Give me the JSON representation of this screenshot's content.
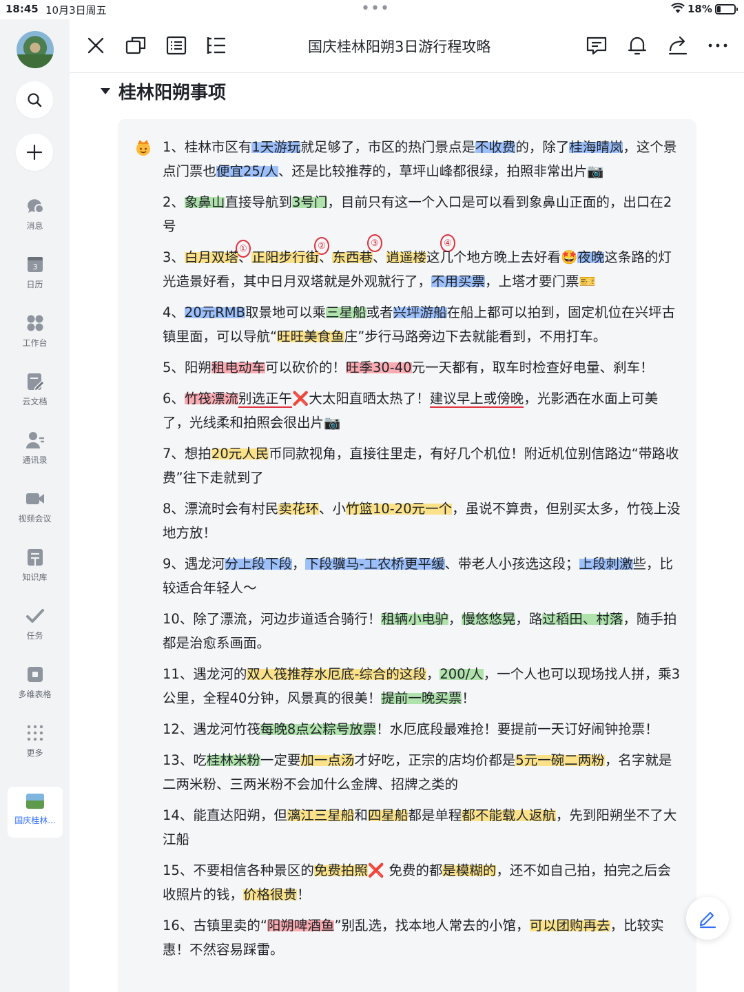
{
  "status": {
    "time": "18:45",
    "date": "10月3日周五",
    "dots": "•••",
    "battery": "18%"
  },
  "sidebar": {
    "items": [
      {
        "label": "消息",
        "icon": "message-icon"
      },
      {
        "label": "日历",
        "icon": "calendar-icon",
        "badge": "3"
      },
      {
        "label": "工作台",
        "icon": "workspace-icon"
      },
      {
        "label": "云文档",
        "icon": "cloud-doc-icon"
      },
      {
        "label": "通讯录",
        "icon": "contacts-icon"
      },
      {
        "label": "视频会议",
        "icon": "video-icon"
      },
      {
        "label": "知识库",
        "icon": "wiki-icon"
      },
      {
        "label": "任务",
        "icon": "task-icon"
      },
      {
        "label": "多维表格",
        "icon": "base-icon"
      },
      {
        "label": "更多",
        "icon": "more-icon"
      }
    ],
    "active_doc": "国庆桂林..."
  },
  "header": {
    "title": "国庆桂林阳朔3日游行程攻略"
  },
  "section": {
    "heading": "桂林阳朔事项"
  },
  "hand_numbers": [
    "①",
    "②",
    "③",
    "④"
  ],
  "items": [
    {
      "segs": [
        [
          "1、桂林市区有",
          ""
        ],
        [
          "1天游玩",
          ""
        ],
        [
          "就足够了，市区的热门景点是",
          ""
        ],
        [
          "不收费",
          ""
        ],
        [
          "的，除了",
          ""
        ],
        [
          "桂海晴岚",
          ""
        ],
        [
          "，这个景点门票也",
          ""
        ],
        [
          "便宜25/人",
          ""
        ],
        [
          "、还是比较推荐的，草坪山峰都很绿，拍照非常出片📷",
          ""
        ]
      ]
    },
    {
      "segs": [
        [
          "2、",
          ""
        ],
        [
          "象鼻山",
          ""
        ],
        [
          "直接导航到",
          ""
        ],
        [
          "3号门",
          ""
        ],
        [
          "，目前只有这一个入口是可以看到象鼻山正面的，出口在2号",
          ""
        ]
      ]
    },
    {
      "segs": [
        [
          "3、",
          ""
        ],
        [
          "白月双塔",
          ""
        ],
        [
          "、",
          ""
        ],
        [
          "正阳步行街",
          ""
        ],
        [
          "、",
          ""
        ],
        [
          "东西巷",
          ""
        ],
        [
          "、",
          ""
        ],
        [
          "逍遥楼",
          ""
        ],
        [
          "这几个地方晚上去好看🤩",
          ""
        ],
        [
          "夜晚",
          ""
        ],
        [
          "这条路的灯光造景好看，其中日月双塔就是外观就行了，",
          ""
        ],
        [
          "不用买票",
          ""
        ],
        [
          "，上塔才要门票🎫",
          ""
        ]
      ]
    },
    {
      "segs": [
        [
          "4、",
          ""
        ],
        [
          "20元RMB",
          ""
        ],
        [
          "取景地可以乘",
          ""
        ],
        [
          "三星船",
          ""
        ],
        [
          "或者",
          ""
        ],
        [
          "兴坪游船",
          ""
        ],
        [
          "在船上都可以拍到，固定机位在兴坪古镇里面，可以导航“",
          ""
        ],
        [
          "旺旺美食鱼",
          ""
        ],
        [
          "庄”步行马路旁边下去就能看到，不用打车。",
          ""
        ]
      ]
    },
    {
      "segs": [
        [
          "5、阳朔",
          ""
        ],
        [
          "租电动车",
          ""
        ],
        [
          "可以砍价的！",
          ""
        ],
        [
          "旺季30-40",
          ""
        ],
        [
          "元一天都有，取车时检查好电量、刹车！",
          ""
        ]
      ]
    },
    {
      "segs": [
        [
          "6、",
          ""
        ],
        [
          "竹筏漂流",
          ""
        ],
        [
          "别选正午",
          ""
        ],
        [
          "❌大太阳直晒太热了！",
          ""
        ],
        [
          "建议早上或傍晚",
          ""
        ],
        [
          "，光影洒在水面上可美了，光线柔和拍照会很出片📷",
          ""
        ]
      ]
    },
    {
      "segs": [
        [
          "7、想拍",
          ""
        ],
        [
          "20元人民",
          ""
        ],
        [
          "币同款视角，直接往里走，有好几个机位！附近机位别信路边“带路收费”往下走就到了",
          ""
        ]
      ]
    },
    {
      "segs": [
        [
          "8、漂流时会有村民",
          ""
        ],
        [
          "卖花环",
          ""
        ],
        [
          "、小",
          ""
        ],
        [
          "竹篮10-20元一个",
          ""
        ],
        [
          "，虽说不算贵，但别买太多，竹筏上没地方放！",
          ""
        ]
      ]
    },
    {
      "segs": [
        [
          "9、遇龙河",
          ""
        ],
        [
          "分上段下段",
          ""
        ],
        [
          "，",
          ""
        ],
        [
          "下段骥马-工农桥更平缓",
          ""
        ],
        [
          "、带老人小孩选这段；",
          ""
        ],
        [
          "上段刺激",
          ""
        ],
        [
          "些，比较适合年轻人～",
          ""
        ]
      ]
    },
    {
      "segs": [
        [
          "10、除了漂流，河边步道适合骑行！",
          ""
        ],
        [
          "租辆小电驴",
          ""
        ],
        [
          "，",
          ""
        ],
        [
          "慢悠悠晃",
          ""
        ],
        [
          "，路",
          ""
        ],
        [
          "过稻田、村落",
          ""
        ],
        [
          "，随手拍都是治愈系画面。",
          ""
        ]
      ]
    },
    {
      "segs": [
        [
          "11、遇龙河的",
          ""
        ],
        [
          "双人筏推荐水厄底-综合的这段",
          ""
        ],
        [
          "，",
          ""
        ],
        [
          "200/人",
          ""
        ],
        [
          "，一个人也可以现场找人拼，乘3公里，全程40分钟，风景真的很美！",
          ""
        ],
        [
          "提前一晚买票",
          ""
        ],
        [
          "！",
          ""
        ]
      ]
    },
    {
      "segs": [
        [
          " 12、遇龙河竹筏",
          ""
        ],
        [
          "每晚8点公粽号放票",
          ""
        ],
        [
          "！水厄底段最难抢！要提前一天订好闹钟抢票！",
          ""
        ]
      ]
    },
    {
      "segs": [
        [
          "13、吃",
          ""
        ],
        [
          "桂林米粉",
          ""
        ],
        [
          "一定要",
          ""
        ],
        [
          "加一点汤",
          ""
        ],
        [
          "才好吃，正宗的店均价都是",
          ""
        ],
        [
          "5元一碗二两粉",
          ""
        ],
        [
          "，名字就是二两米粉、三两米粉不会加什么金牌、招牌之类的",
          ""
        ]
      ]
    },
    {
      "segs": [
        [
          "14、能直达阳朔，但",
          ""
        ],
        [
          "漓江三星船",
          ""
        ],
        [
          "和",
          ""
        ],
        [
          "四星船",
          ""
        ],
        [
          "都是单程",
          ""
        ],
        [
          "都不能载人返航",
          ""
        ],
        [
          "，先到阳朔坐不了大江船",
          ""
        ]
      ]
    },
    {
      "segs": [
        [
          "15、不要相信各种景区的",
          ""
        ],
        [
          "免费拍照",
          ""
        ],
        [
          "❌ 免费的都",
          ""
        ],
        [
          "是模糊的",
          ""
        ],
        [
          "，还不如自己拍，拍完之后会收照片的钱，",
          ""
        ],
        [
          "价格很贵",
          ""
        ],
        [
          "！",
          ""
        ]
      ]
    },
    {
      "segs": [
        [
          "16、古镇里卖的“",
          ""
        ],
        [
          "阳朔啤酒鱼",
          ""
        ],
        [
          "”别乱选，找本地人常去的小馆，",
          ""
        ],
        [
          "可以团购再去",
          ""
        ],
        [
          "，比较实惠！不然容易踩雷。",
          ""
        ]
      ]
    }
  ],
  "highlight_map": {
    "item0": [
      "",
      "b",
      "",
      "b",
      "",
      "b",
      "",
      "b",
      ""
    ],
    "item1": [
      "",
      "g",
      "",
      "g",
      ""
    ],
    "item2": [
      "",
      "y",
      "",
      "y",
      "",
      "y",
      "",
      "y",
      "",
      "b",
      "",
      "b",
      ""
    ],
    "item3": [
      "",
      "b",
      "",
      "g",
      "",
      "b",
      "",
      "y",
      ""
    ],
    "item4": [
      "",
      "r",
      "",
      "r",
      ""
    ],
    "item5": [
      "",
      "r",
      "r-ul",
      "",
      "r-ul",
      ""
    ],
    "item6": [
      "",
      "y",
      ""
    ],
    "item7": [
      "",
      "y",
      "",
      "y",
      ""
    ],
    "item8": [
      "",
      "b",
      "",
      "b",
      "",
      "b",
      ""
    ],
    "item9": [
      "",
      "g",
      "",
      "g",
      "",
      "g",
      ""
    ],
    "item10": [
      "",
      "y",
      "",
      "g",
      "",
      "g",
      ""
    ],
    "item11": [
      "",
      "g",
      ""
    ],
    "item12": [
      "",
      "g",
      "",
      "y",
      "",
      "y",
      ""
    ],
    "item13": [
      "",
      "y",
      "",
      "y",
      "",
      "y",
      ""
    ],
    "item14": [
      "",
      "y",
      "",
      "y",
      "",
      "y",
      ""
    ],
    "item15": [
      "",
      "r",
      "",
      "y",
      ""
    ]
  },
  "colors": {
    "accent": "#3370ff",
    "highlight_blue": "#5494ff",
    "highlight_green": "#78d26e",
    "highlight_yellow": "#ffd646",
    "highlight_red": "#ff6e78",
    "annotation_red": "#e0303e"
  }
}
